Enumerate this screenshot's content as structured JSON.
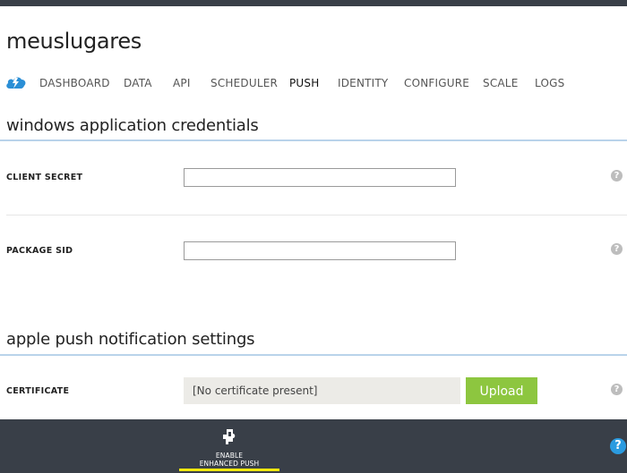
{
  "app": {
    "title": "meuslugares"
  },
  "nav": {
    "tabs": [
      {
        "label": "DASHBOARD"
      },
      {
        "label": "DATA"
      },
      {
        "label": "API"
      },
      {
        "label": "SCHEDULER"
      },
      {
        "label": "PUSH"
      },
      {
        "label": "IDENTITY"
      },
      {
        "label": "CONFIGURE"
      },
      {
        "label": "SCALE"
      },
      {
        "label": "LOGS"
      }
    ],
    "active_tab": "PUSH"
  },
  "windows_section": {
    "title": "windows application credentials",
    "client_secret": {
      "label": "CLIENT SECRET",
      "value": ""
    },
    "package_sid": {
      "label": "PACKAGE SID",
      "value": ""
    }
  },
  "apple_section": {
    "title": "apple push notification settings",
    "certificate": {
      "label": "CERTIFICATE",
      "value": "[No certificate present]"
    },
    "upload_label": "Upload"
  },
  "help_glyph": "?",
  "footer": {
    "command": {
      "line1": "ENABLE",
      "line2": "ENHANCED PUSH"
    },
    "help_glyph": "?"
  },
  "colors": {
    "top_bar": "#393f48",
    "footer": "#393f48",
    "accent_blue": "#2b9be0",
    "upload_green": "#8dc63f",
    "active_underline": "#f0e80f",
    "section_rule": "#b9d3ea"
  },
  "icons": {
    "service": "cloud-lightning-icon",
    "help": "question-mark-icon",
    "command": "enhanced-push-icon"
  }
}
